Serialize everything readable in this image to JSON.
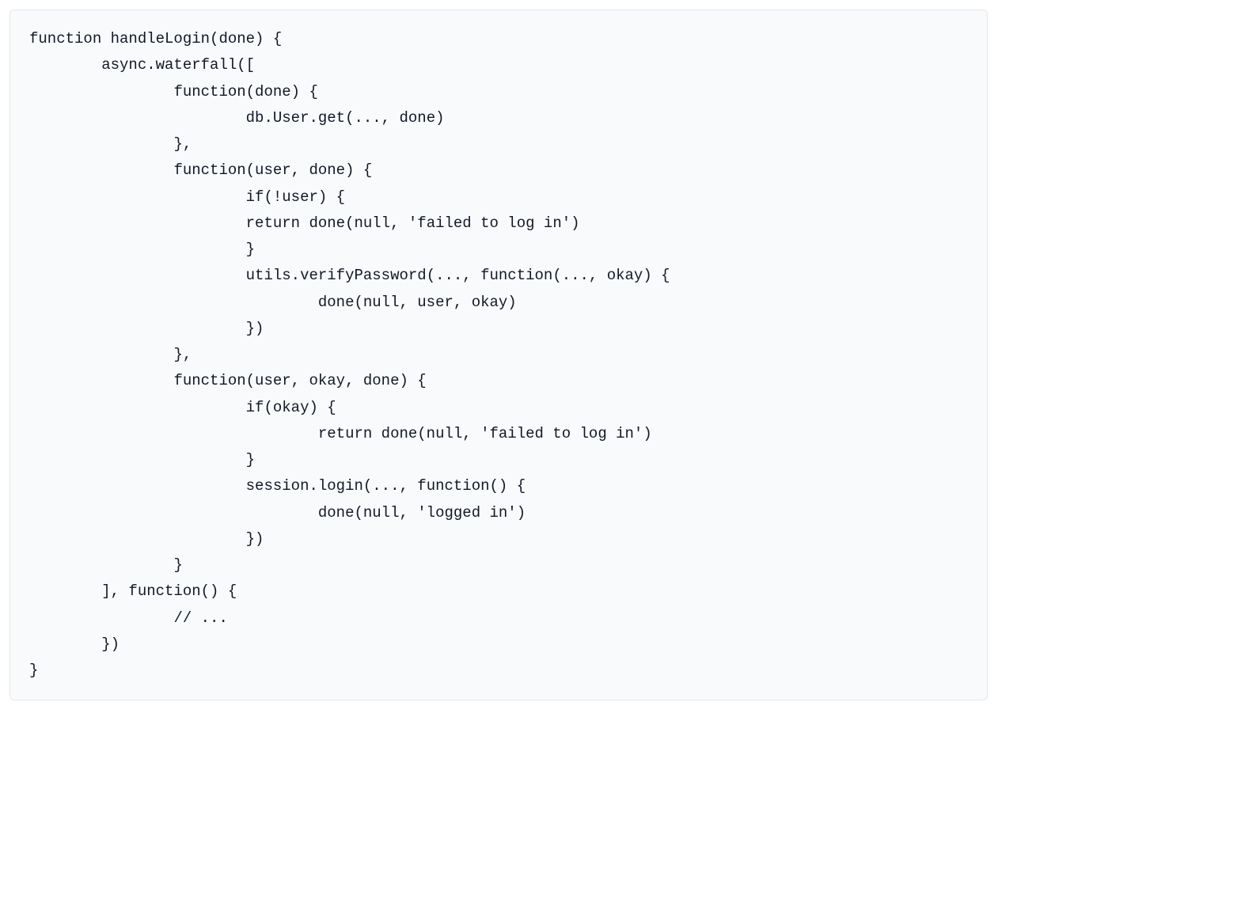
{
  "code": "function handleLogin(done) {\n\tasync.waterfall([\n\t\tfunction(done) {\n\t\t\tdb.User.get(..., done)\n\t\t},\n\t\tfunction(user, done) {\n\t\t\tif(!user) {\n\t\t\treturn done(null, 'failed to log in')\n\t\t\t}\n\t\t\tutils.verifyPassword(..., function(..., okay) {\n\t\t\t\tdone(null, user, okay)\n\t\t\t})\n\t\t},\n\t\tfunction(user, okay, done) {\n\t\t\tif(okay) {\n\t\t\t\treturn done(null, 'failed to log in')\n\t\t\t}\n\t\t\tsession.login(..., function() {\n\t\t\t\tdone(null, 'logged in')\n\t\t\t})\n\t\t}\n\t], function() {\n\t\t// ...\n\t})\n}"
}
